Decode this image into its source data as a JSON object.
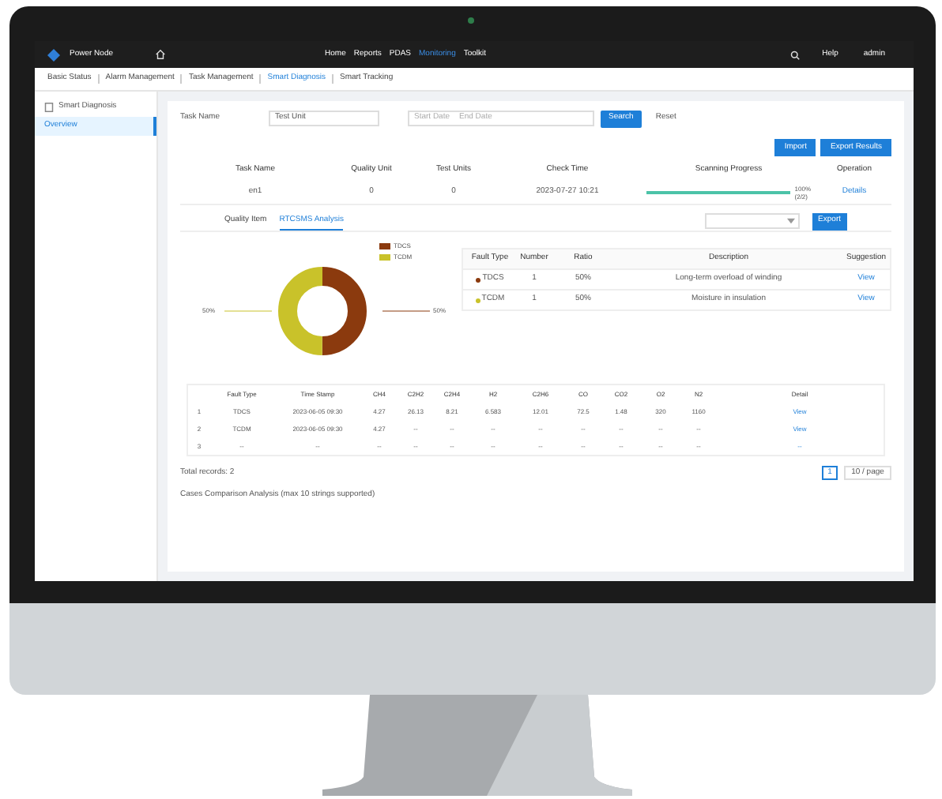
{
  "app": {
    "logo": "Power Node",
    "nav": [
      {
        "label": "Home",
        "selected": false
      },
      {
        "label": "Reports",
        "selected": false
      },
      {
        "label": "PDAS",
        "selected": false
      },
      {
        "label": "Monitoring",
        "selected": true
      },
      {
        "label": "Toolkit",
        "selected": false
      }
    ],
    "help": "Help",
    "user": "admin"
  },
  "subnav": [
    {
      "label": "Basic Status",
      "selected": false
    },
    {
      "label": "Alarm Management",
      "selected": false
    },
    {
      "label": "Task Management",
      "selected": false
    },
    {
      "label": "Smart Diagnosis",
      "selected": true
    },
    {
      "label": "Smart Tracking",
      "selected": false
    }
  ],
  "sidebar": {
    "header": "Smart Diagnosis",
    "items": [
      {
        "label": "Overview",
        "selected": true
      }
    ]
  },
  "filters": {
    "label": "Task Name",
    "select": "Test Unit",
    "date_start": "Start Date",
    "date_end": "End Date",
    "search": "Search",
    "reset": "Reset"
  },
  "actions": [
    "Import",
    "Export Results"
  ],
  "task_table": {
    "columns": [
      "Task Name",
      "Quality Unit",
      "Test Units",
      "Check Time",
      "Scanning Progress",
      "Operation"
    ],
    "row": {
      "cells": [
        "en1",
        "0",
        "0",
        "2023-07-27 10:21"
      ],
      "level": 1,
      "reading": "100%",
      "reading_2": "(2/2)",
      "action": "Details"
    }
  },
  "tabs": [
    {
      "label": "Quality Item",
      "selected": false
    },
    {
      "label": "RTCSMS Analysis",
      "selected": true
    }
  ],
  "export": "Export",
  "legend": [
    {
      "label": "TDCS",
      "color": "#8b3a0e"
    },
    {
      "label": "TCDM",
      "color": "#c9c22a"
    }
  ],
  "donut_labels": [
    "50%",
    "50%"
  ],
  "fault_table": {
    "columns": [
      "Fault Type",
      "Number",
      "Ratio",
      "Description",
      "Suggestion"
    ],
    "rows": [
      {
        "cells": [
          "TDCS",
          "1",
          "50%",
          "Long-term overload of winding",
          "View"
        ],
        "color": "#8b3a0e"
      },
      {
        "cells": [
          "TCDM",
          "1",
          "50%",
          "Moisture in insulation",
          "View"
        ],
        "color": "#c9c22a"
      }
    ]
  },
  "data_table": {
    "columns": [
      "",
      "Fault Type",
      "Time Stamp",
      "CH4",
      "C2H2",
      "C2H4",
      "H2",
      "C2H6",
      "CO",
      "CO2",
      "O2",
      "N2",
      "Detail"
    ],
    "rows": [
      [
        "1",
        "TDCS",
        "2023-06-05 09:30",
        "4.27",
        "26.13",
        "8.21",
        "6.583",
        "12.01",
        "72.5",
        "1.48",
        "320",
        "1160",
        "View"
      ],
      [
        "2",
        "TCDM",
        "2023-06-05 09:30",
        "4.27",
        "--",
        "--",
        "--",
        "--",
        "--",
        "--",
        "--",
        "--",
        "View"
      ],
      [
        "3",
        "--",
        "--",
        "--",
        "--",
        "--",
        "--",
        "--",
        "--",
        "--",
        "--",
        "--",
        "--"
      ]
    ]
  },
  "total": "Total records: 2",
  "page": "1",
  "page_size": "10 / page",
  "footer_note": "Cases Comparison Analysis (max 10 strings supported)"
}
